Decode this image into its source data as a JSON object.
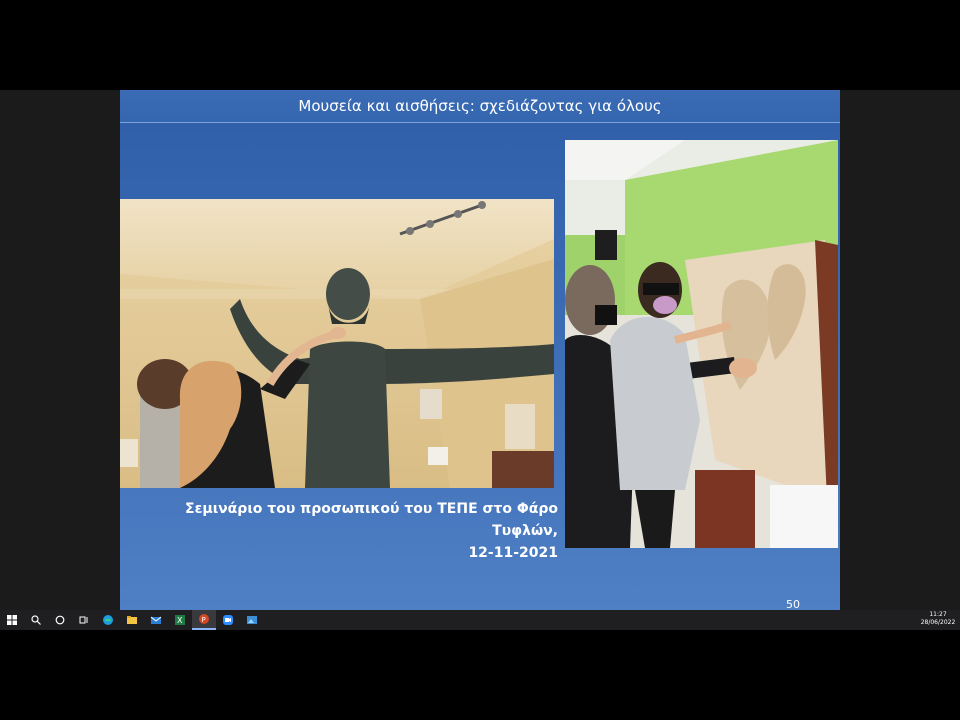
{
  "slide": {
    "title": "Μουσεία και αισθήσεις: σχεδιάζοντας για όλους",
    "caption_line1": "Σεμινάριο του προσωπικού του ΤΕΠΕ στο Φάρο Τυφλών,",
    "caption_line2": "12-11-2021",
    "number": "50",
    "photos": [
      {
        "name": "Bronze statue touched by visitors",
        "icon": "photo"
      },
      {
        "name": "Visitors touching relief",
        "icon": "photo"
      }
    ]
  },
  "taskbar": {
    "apps": [
      {
        "name": "start",
        "icon": "windows-icon"
      },
      {
        "name": "search",
        "icon": "search-icon"
      },
      {
        "name": "cortana",
        "icon": "circle-icon"
      },
      {
        "name": "task-view",
        "icon": "task-view-icon"
      },
      {
        "name": "edge",
        "icon": "edge-icon"
      },
      {
        "name": "file-explorer",
        "icon": "folder-icon"
      },
      {
        "name": "mail",
        "icon": "mail-icon"
      },
      {
        "name": "excel",
        "icon": "excel-icon"
      },
      {
        "name": "powerpoint",
        "icon": "powerpoint-icon",
        "active": true
      },
      {
        "name": "zoom",
        "icon": "zoom-icon"
      },
      {
        "name": "photos",
        "icon": "photos-icon"
      }
    ],
    "time": "11:27",
    "date": "28/06/2022"
  },
  "colors": {
    "slide_bg": "#3a6bb4",
    "taskbar_bg": "#1f1f22"
  }
}
